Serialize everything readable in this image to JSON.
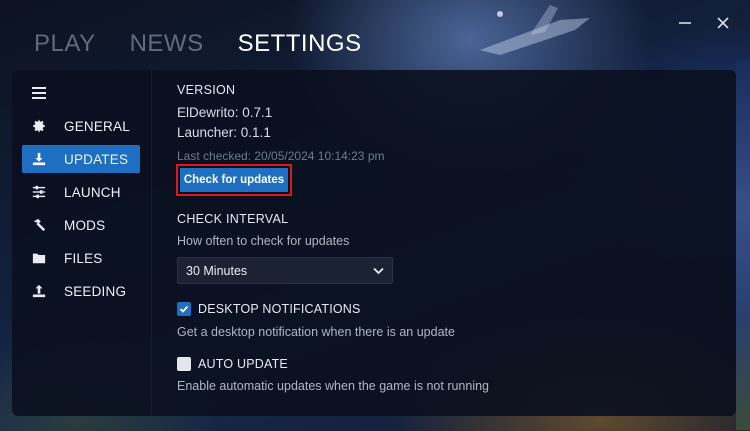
{
  "top_tabs": [
    {
      "label": "PLAY"
    },
    {
      "label": "NEWS"
    },
    {
      "label": "SETTINGS"
    }
  ],
  "sidebar": {
    "items": [
      {
        "label": "GENERAL",
        "icon": "gear-icon"
      },
      {
        "label": "UPDATES",
        "icon": "download-icon"
      },
      {
        "label": "LAUNCH",
        "icon": "sliders-icon"
      },
      {
        "label": "MODS",
        "icon": "hammer-icon"
      },
      {
        "label": "FILES",
        "icon": "folder-icon"
      },
      {
        "label": "SEEDING",
        "icon": "upload-icon"
      }
    ],
    "active": "UPDATES"
  },
  "version": {
    "title": "VERSION",
    "eldewrito": "ElDewrito: 0.7.1",
    "launcher": "Launcher: 0.1.1",
    "last_checked": "Last checked: 20/05/2024 10:14:23 pm",
    "check_button": "Check for updates"
  },
  "check_interval": {
    "title": "CHECK INTERVAL",
    "description": "How often to check for updates",
    "selected": "30 Minutes"
  },
  "desktop_notifications": {
    "label": "DESKTOP NOTIFICATIONS",
    "checked": true,
    "description": "Get a desktop notification when there is an update"
  },
  "auto_update": {
    "label": "AUTO UPDATE",
    "checked": false,
    "description": "Enable automatic updates when the game is not running"
  },
  "colors": {
    "accent": "#1e6fc1",
    "highlight_border": "#e01818",
    "panel_bg": "#0a101e"
  }
}
